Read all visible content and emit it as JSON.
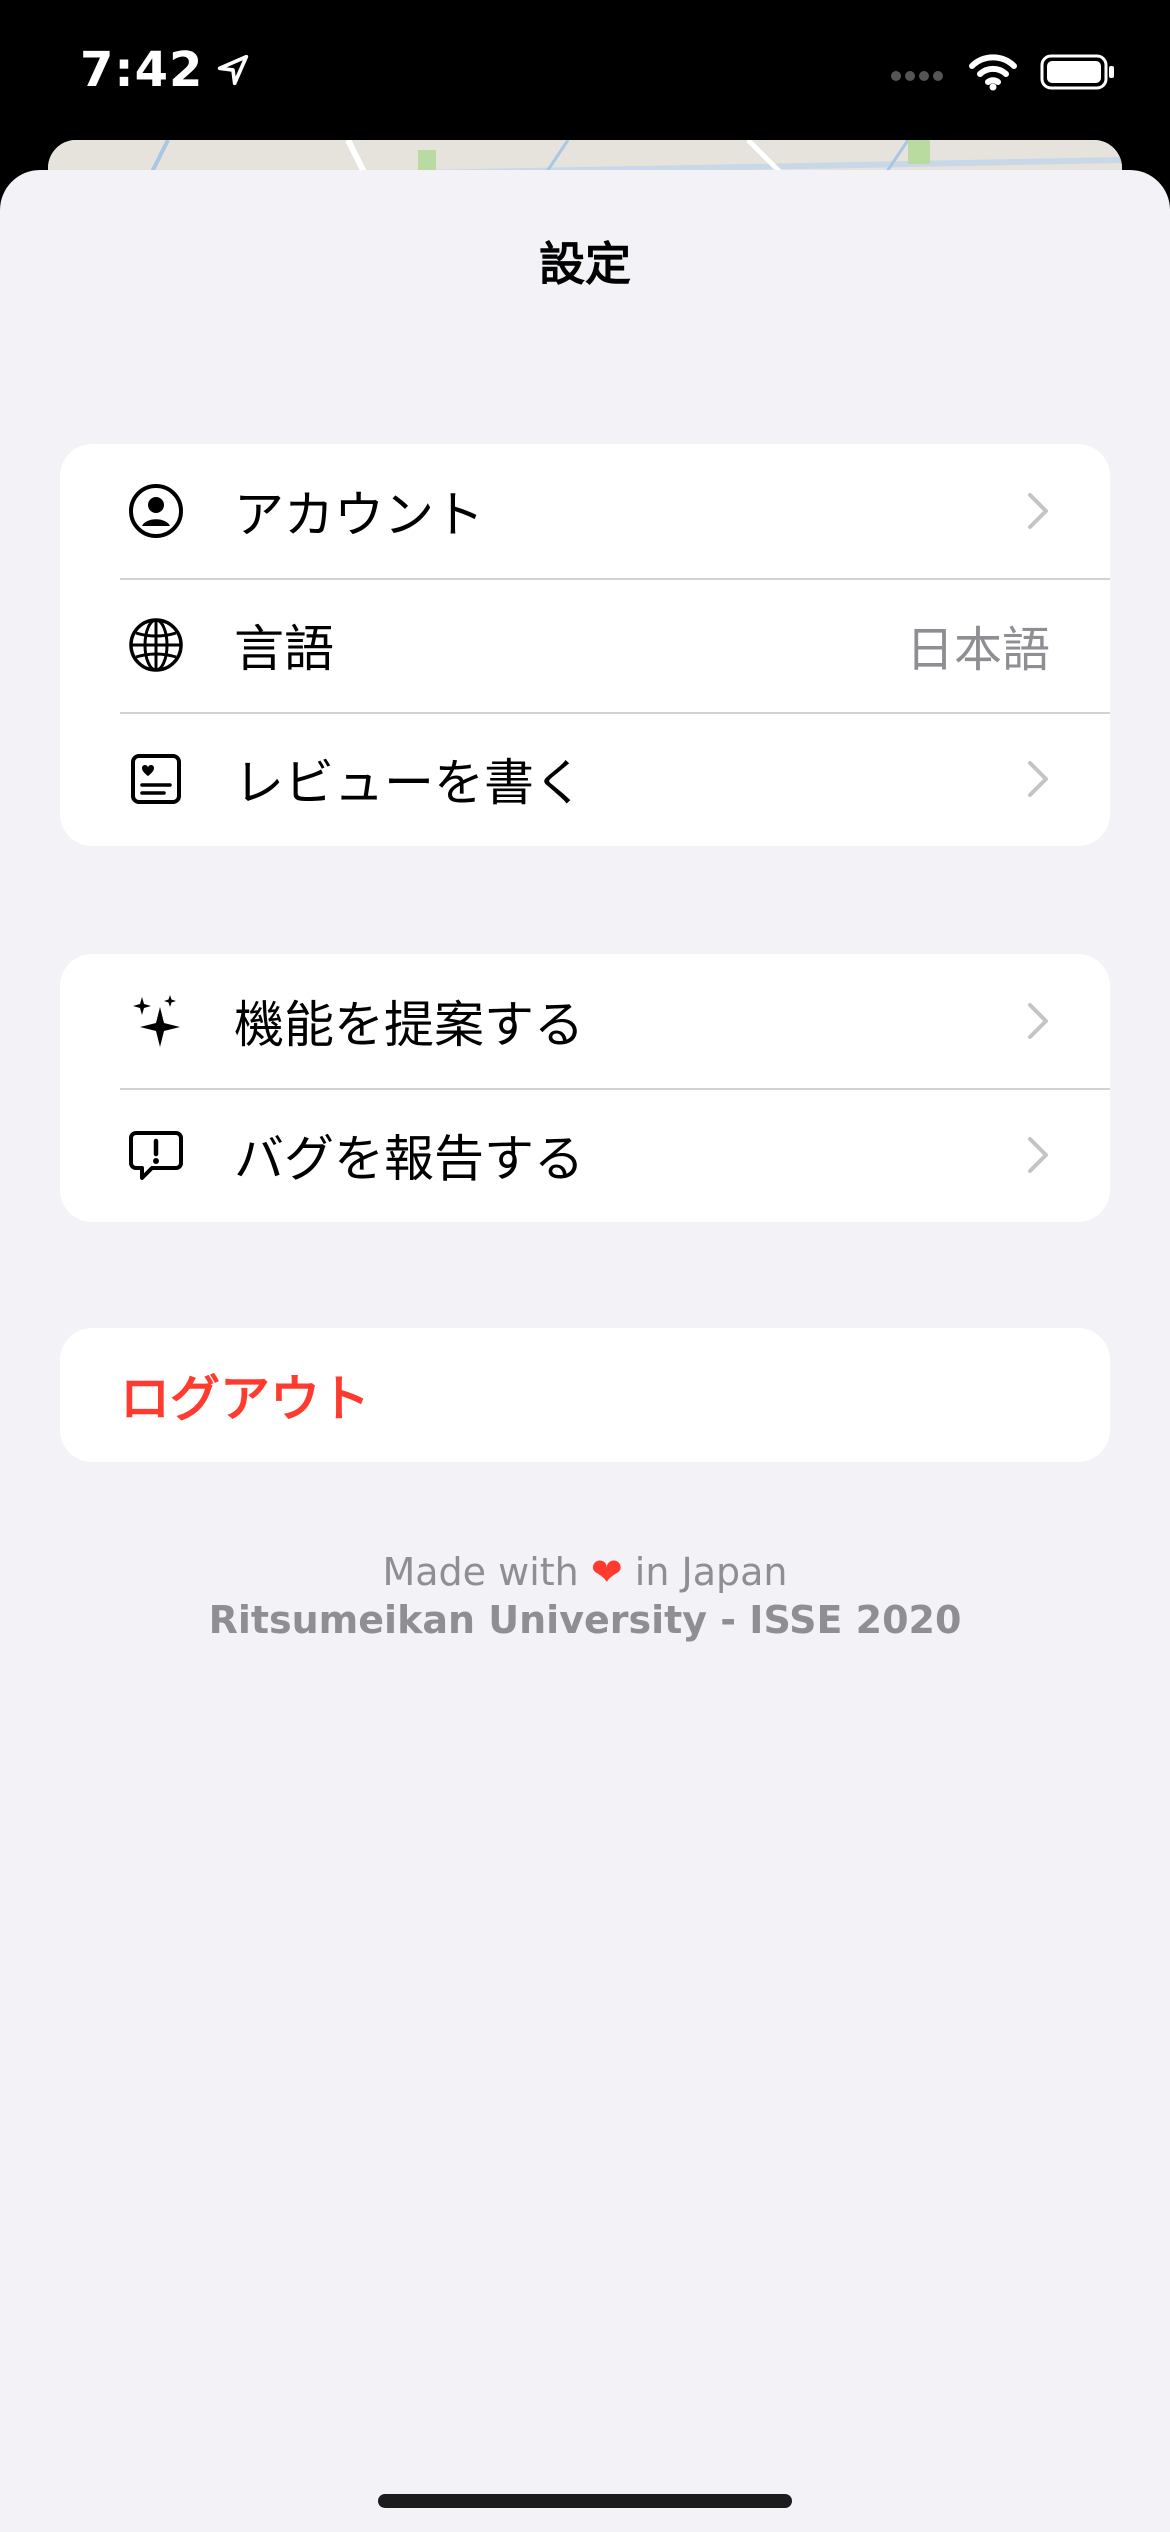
{
  "status_bar": {
    "time": "7:42",
    "icons": [
      "location-arrow-icon",
      "signal-icon",
      "wifi-icon",
      "battery-icon"
    ]
  },
  "sheet": {
    "title": "設定"
  },
  "groups": {
    "account": {
      "label": "アカウント",
      "icon": "person-circle-icon"
    },
    "language": {
      "label": "言語",
      "value": "日本語",
      "icon": "globe-icon"
    },
    "review": {
      "label": "レビューを書く",
      "icon": "review-card-icon"
    },
    "suggest": {
      "label": "機能を提案する",
      "icon": "sparkles-icon"
    },
    "bug": {
      "label": "バグを報告する",
      "icon": "exclamation-bubble-icon"
    },
    "logout": {
      "label": "ログアウト"
    }
  },
  "footer": {
    "made_with": "Made with",
    "heart": "❤",
    "in_japan": "in Japan",
    "credit": "Ritsumeikan University - ISSE 2020"
  },
  "colors": {
    "background": "#f2f2f7",
    "destructive": "#ff3b30",
    "secondary_text": "#8e8e93"
  }
}
